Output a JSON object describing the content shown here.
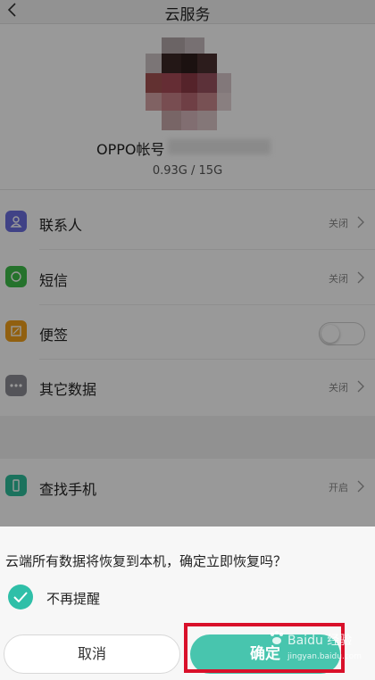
{
  "header": {
    "title": "云服务"
  },
  "profile": {
    "account_label": "OPPO帐号",
    "storage": "0.93G / 15G"
  },
  "list": {
    "contacts": {
      "label": "联系人",
      "status": "关闭"
    },
    "sms": {
      "label": "短信",
      "status": "关闭"
    },
    "notes": {
      "label": "便签",
      "toggle_on": false
    },
    "other": {
      "label": "其它数据",
      "status": "关闭"
    },
    "find_phone": {
      "label": "查找手机",
      "status": "开启"
    }
  },
  "dialog": {
    "message": "云端所有数据将恢复到本机，确定立即恢复吗？",
    "checkbox_label": "不再提醒",
    "checkbox_checked": true,
    "cancel_label": "取消",
    "confirm_label": "确定"
  },
  "watermark": {
    "text": "Baidu 经验",
    "sub": "jingyan.baidu.com"
  },
  "colors": {
    "accent": "#48c5ae",
    "highlight": "#d9102a",
    "contacts_icon": "#6b6fe0",
    "sms_icon": "#3fbf4a",
    "notes_icon": "#f2a11c",
    "other_icon": "#8d8d95",
    "find_icon": "#2dbf9c"
  }
}
